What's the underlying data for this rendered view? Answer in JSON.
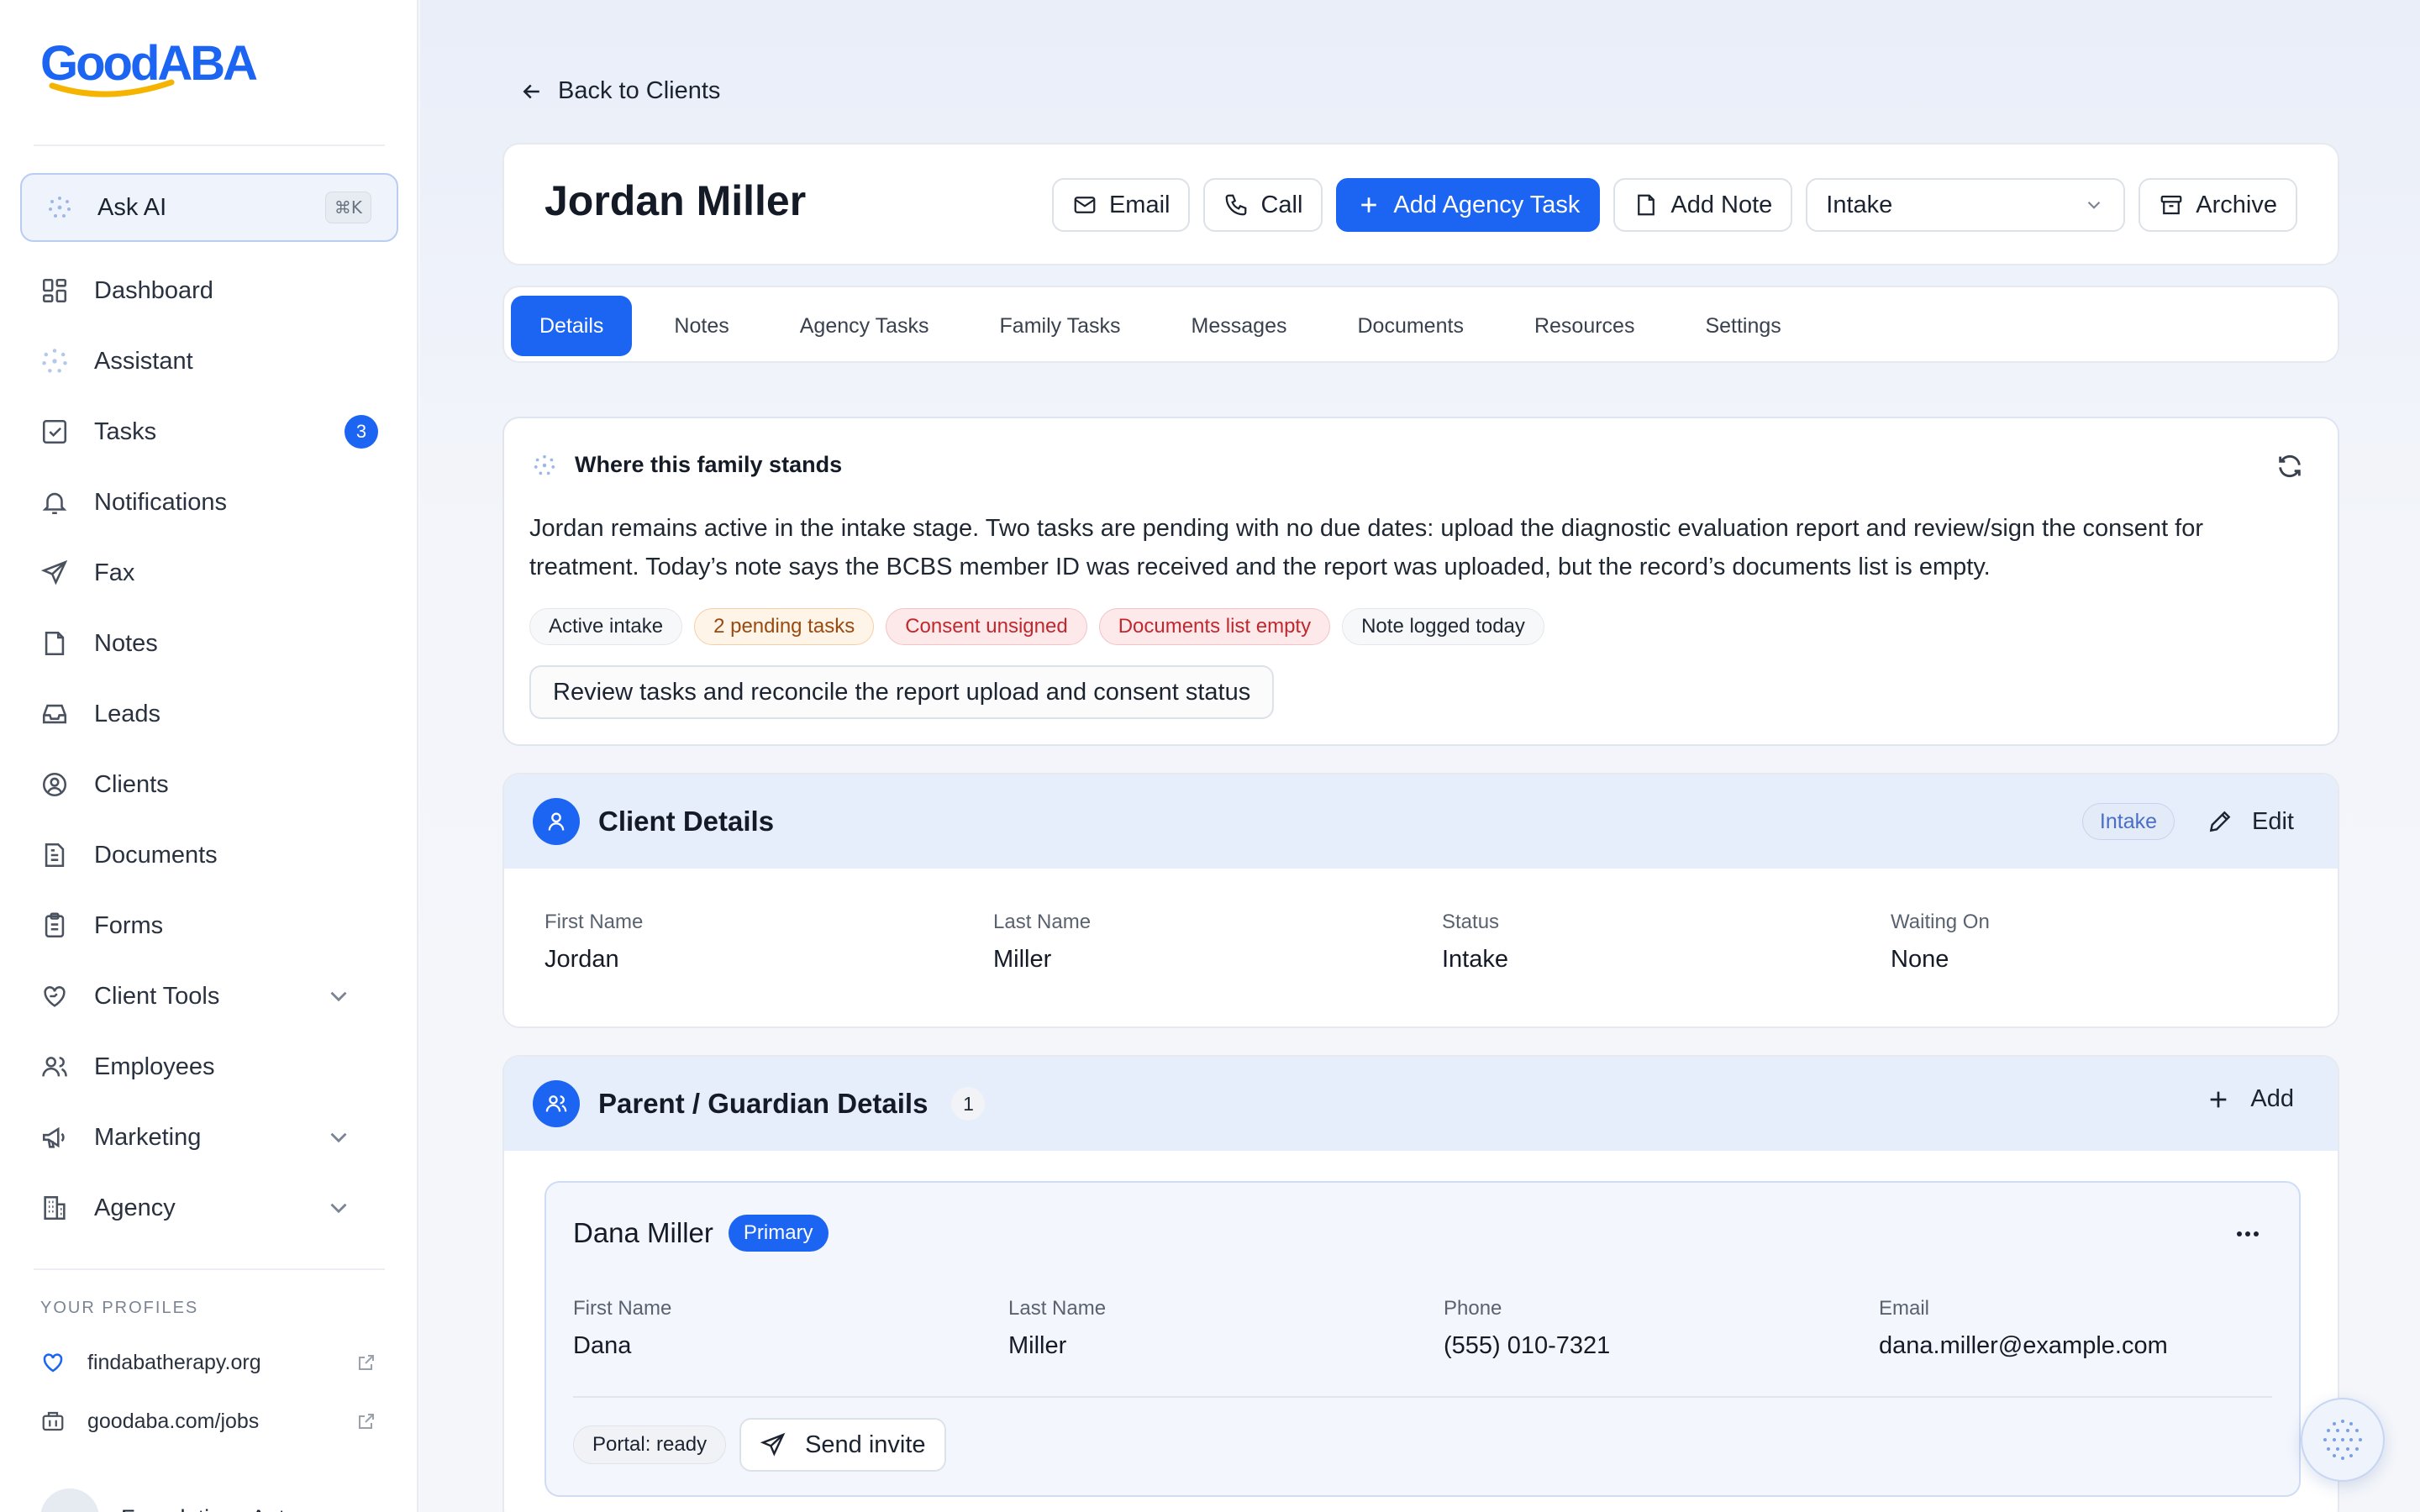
{
  "sidebar": {
    "logo": "GoodABA",
    "ask_ai": {
      "label": "Ask AI",
      "shortcut": "⌘K"
    },
    "items": [
      {
        "label": "Dashboard",
        "icon": "dashboard-icon"
      },
      {
        "label": "Assistant",
        "icon": "assistant-dots-icon"
      },
      {
        "label": "Tasks",
        "icon": "tasks-icon",
        "badge": "3"
      },
      {
        "label": "Notifications",
        "icon": "bell-icon"
      },
      {
        "label": "Fax",
        "icon": "send-icon"
      },
      {
        "label": "Notes",
        "icon": "note-icon"
      },
      {
        "label": "Leads",
        "icon": "inbox-icon"
      },
      {
        "label": "Clients",
        "icon": "user-circle-icon"
      },
      {
        "label": "Documents",
        "icon": "document-icon"
      },
      {
        "label": "Forms",
        "icon": "clipboard-icon"
      },
      {
        "label": "Client Tools",
        "icon": "heart-hand-icon",
        "expandable": true
      },
      {
        "label": "Employees",
        "icon": "users-icon"
      },
      {
        "label": "Marketing",
        "icon": "megaphone-icon",
        "expandable": true
      },
      {
        "label": "Agency",
        "icon": "building-icon",
        "expandable": true
      }
    ],
    "profiles_title": "YOUR PROFILES",
    "profiles": [
      {
        "label": "findabatherapy.org",
        "icon": "heart-icon"
      },
      {
        "label": "goodaba.com/jobs",
        "icon": "briefcase-icon"
      }
    ],
    "org_name": "Foundations Aut"
  },
  "main": {
    "back_label": "Back to Clients",
    "client_name": "Jordan Miller",
    "actions": {
      "email": "Email",
      "call": "Call",
      "add_task": "Add Agency Task",
      "add_note": "Add Note",
      "status_select": "Intake",
      "archive": "Archive"
    },
    "tabs": [
      "Details",
      "Notes",
      "Agency Tasks",
      "Family Tasks",
      "Messages",
      "Documents",
      "Resources",
      "Settings"
    ],
    "active_tab": "Details",
    "summary": {
      "title": "Where this family stands",
      "text": "Jordan remains active in the intake stage. Two tasks are pending with no due dates: upload the diagnostic evaluation report and review/sign the consent for treatment. Today’s note says the BCBS member ID was received and the report was uploaded, but the record’s documents list is empty.",
      "chips": [
        {
          "label": "Active intake",
          "tone": "neutral"
        },
        {
          "label": "2 pending tasks",
          "tone": "warn"
        },
        {
          "label": "Consent unsigned",
          "tone": "danger"
        },
        {
          "label": "Documents list empty",
          "tone": "danger"
        },
        {
          "label": "Note logged today",
          "tone": "neutral"
        }
      ],
      "cta": "Review tasks and reconcile the report upload and consent status"
    },
    "client_details": {
      "title": "Client Details",
      "status_pill": "Intake",
      "edit_label": "Edit",
      "fields": [
        {
          "label": "First Name",
          "value": "Jordan"
        },
        {
          "label": "Last Name",
          "value": "Miller"
        },
        {
          "label": "Status",
          "value": "Intake"
        },
        {
          "label": "Waiting On",
          "value": "None"
        }
      ]
    },
    "guardians": {
      "title": "Parent / Guardian Details",
      "count": "1",
      "add_label": "Add",
      "items": [
        {
          "name": "Dana Miller",
          "badge": "Primary",
          "fields": [
            {
              "label": "First Name",
              "value": "Dana"
            },
            {
              "label": "Last Name",
              "value": "Miller"
            },
            {
              "label": "Phone",
              "value": "(555) 010-7321"
            },
            {
              "label": "Email",
              "value": "dana.miller@example.com"
            }
          ],
          "portal_status": "Portal: ready",
          "invite_label": "Send invite"
        }
      ]
    }
  },
  "colors": {
    "accent": "#1c64f2",
    "warn": "#9a4a10",
    "danger": "#c0282f"
  }
}
